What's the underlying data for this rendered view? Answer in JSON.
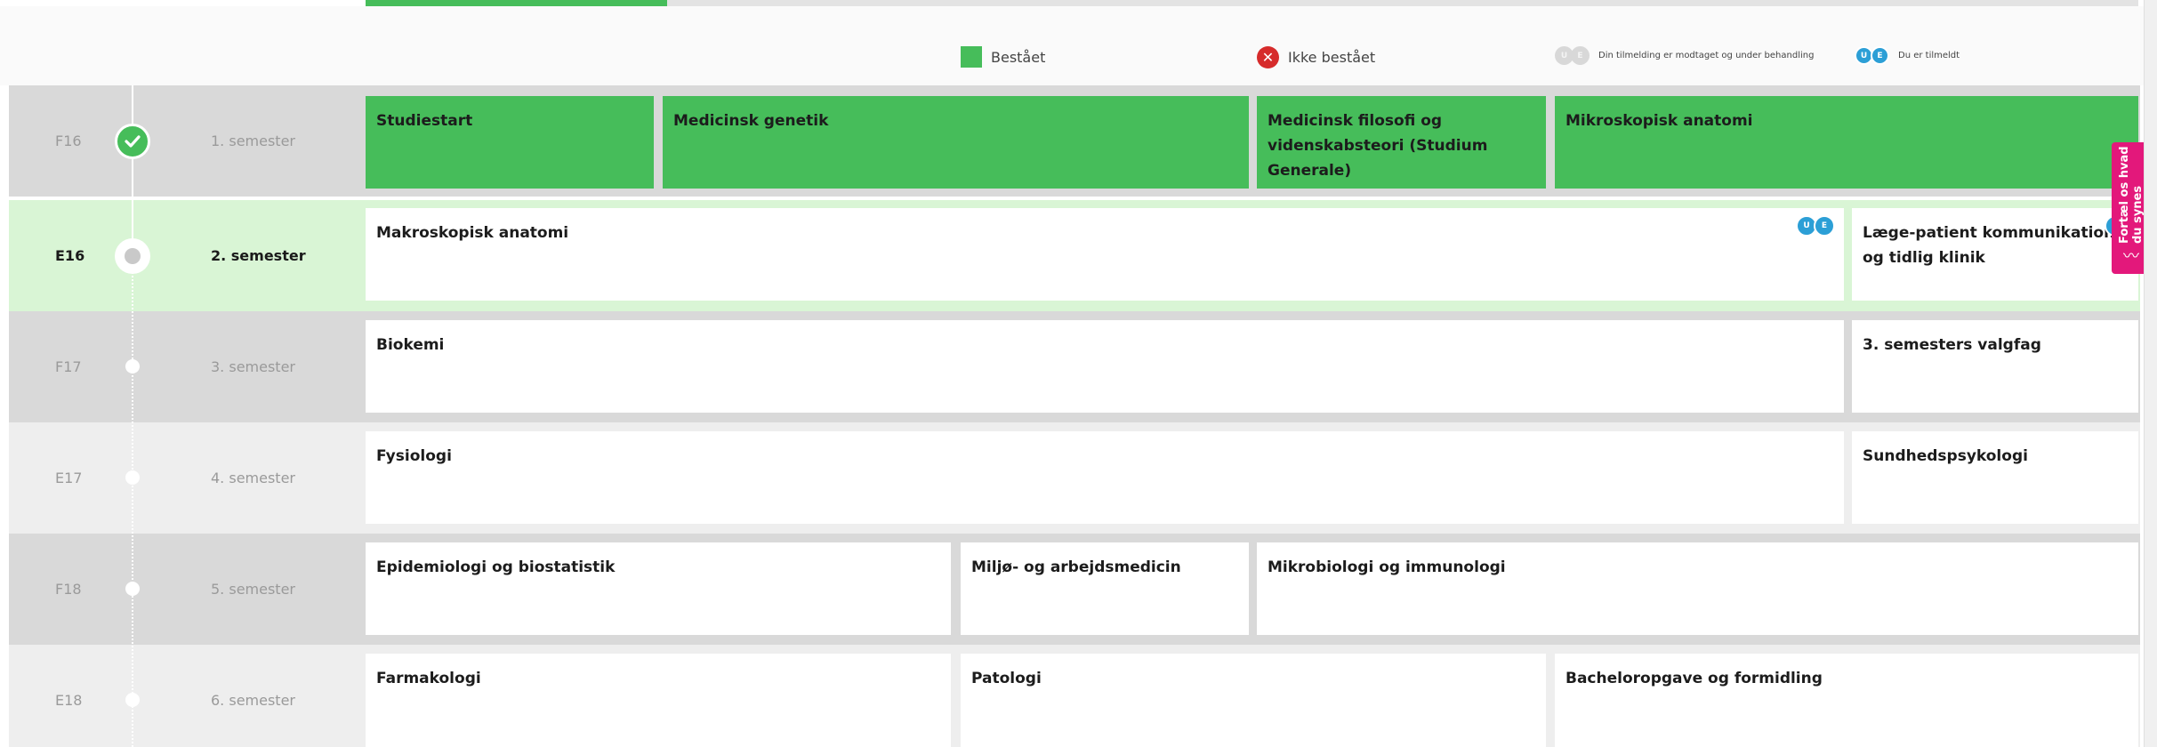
{
  "legend": {
    "passed": "Bestået",
    "failed": "Ikke bestået",
    "failed_icon": "close-icon",
    "pending": "Din tilmelding er modtaget og under behandling",
    "enrolled": "Du er tilmeldt",
    "badge_u": "U",
    "badge_e": "E"
  },
  "progress": {
    "completed_fraction": 0.17
  },
  "semesters": [
    {
      "term": "F16",
      "label": "1. semester",
      "status": "passed",
      "courses": [
        "Studiestart",
        "Medicinsk genetik",
        "Medicinsk filosofi og videnskabsteori (Studium Generale)",
        "Mikroskopisk anatomi"
      ]
    },
    {
      "term": "E16",
      "label": "2. semester",
      "status": "current",
      "courses": [
        "Makroskopisk anatomi",
        "Læge-patient kommunikation og tidlig klinik"
      ]
    },
    {
      "term": "F17",
      "label": "3. semester",
      "courses": [
        "Biokemi",
        "3. semesters valgfag"
      ]
    },
    {
      "term": "E17",
      "label": "4. semester",
      "courses": [
        "Fysiologi",
        "Sundhedspsykologi"
      ]
    },
    {
      "term": "F18",
      "label": "5. semester",
      "courses": [
        "Epidemiologi og biostatistik",
        "Miljø- og arbejdsmedicin",
        "Mikrobiologi og immunologi"
      ]
    },
    {
      "term": "E18",
      "label": "6. semester",
      "courses": [
        "Farmakologi",
        "Patologi",
        "Bacheloropgave og formidling"
      ]
    }
  ],
  "feedback": {
    "label": "Fortæl os hvad du synes",
    "icon": "wave-icon"
  },
  "colors": {
    "passed": "#46bd5a",
    "failed": "#d62b2b",
    "enrolled": "#2c9fd6",
    "current_row": "#d9f5d5",
    "feedback": "#e3187b"
  }
}
